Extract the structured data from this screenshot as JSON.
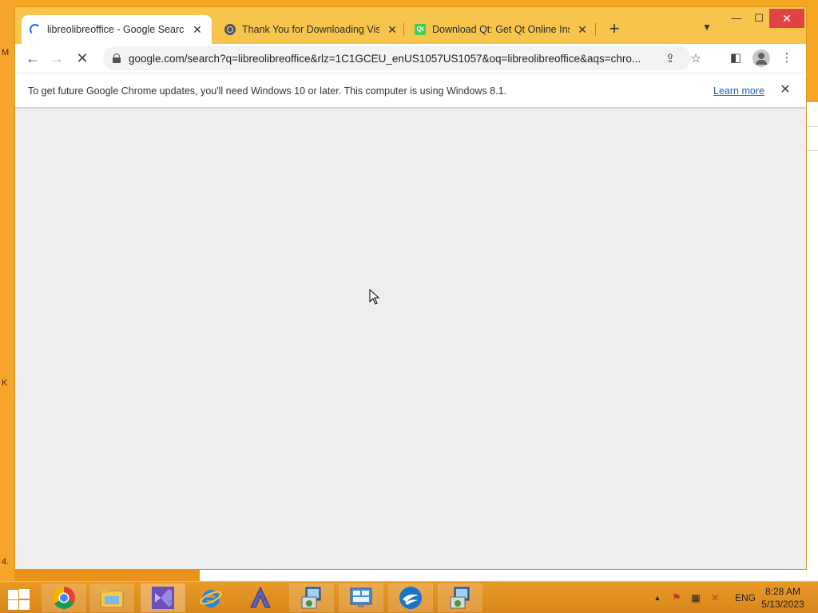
{
  "desktop": {
    "left_edge_letters": [
      "M",
      "K",
      "4."
    ]
  },
  "browser": {
    "tabs": [
      {
        "title": "libreolibreoffice - Google Search",
        "active": true,
        "favicon": "loading-spinner-icon"
      },
      {
        "title": "Thank You for Downloading Visu",
        "active": false,
        "favicon": "globe-icon"
      },
      {
        "title": "Download Qt: Get Qt Online Inst",
        "active": false,
        "favicon": "qt-icon",
        "favicon_text": "Qt"
      }
    ],
    "new_tab_label": "+",
    "url": "google.com/search?q=libreolibreoffice&rlz=1C1GCEU_enUS1057US1057&oq=libreolibreoffice&aqs=chro...",
    "infobar": {
      "message": "To get future Google Chrome updates, you'll need Windows 10 or later. This computer is using Windows 8.1.",
      "link": "Learn more"
    },
    "colors": {
      "titlebar": "#f8c54c",
      "active_tab": "#ffffff",
      "close_button": "#e04343",
      "content_bg": "#eeeeee",
      "link": "#1a5fb4"
    }
  },
  "taskbar": {
    "apps": [
      {
        "name": "Google Chrome",
        "icon": "chrome-icon"
      },
      {
        "name": "File Explorer",
        "icon": "folder-icon"
      },
      {
        "name": "Visual Studio Installer",
        "icon": "visual-studio-icon"
      },
      {
        "name": "Internet Explorer",
        "icon": "internet-explorer-icon"
      },
      {
        "name": "Inkscape-like app",
        "icon": "app-a-icon"
      },
      {
        "name": "Installer",
        "icon": "installer-icon"
      },
      {
        "name": "Control Panel",
        "icon": "control-panel-icon"
      },
      {
        "name": "OpenOffice",
        "icon": "openoffice-icon"
      },
      {
        "name": "Installer 2",
        "icon": "installer-icon"
      }
    ],
    "tray": {
      "language": "ENG",
      "time": "8:28 AM",
      "date": "5/13/2023"
    },
    "colors": {
      "taskbar": "#e0901f"
    }
  }
}
